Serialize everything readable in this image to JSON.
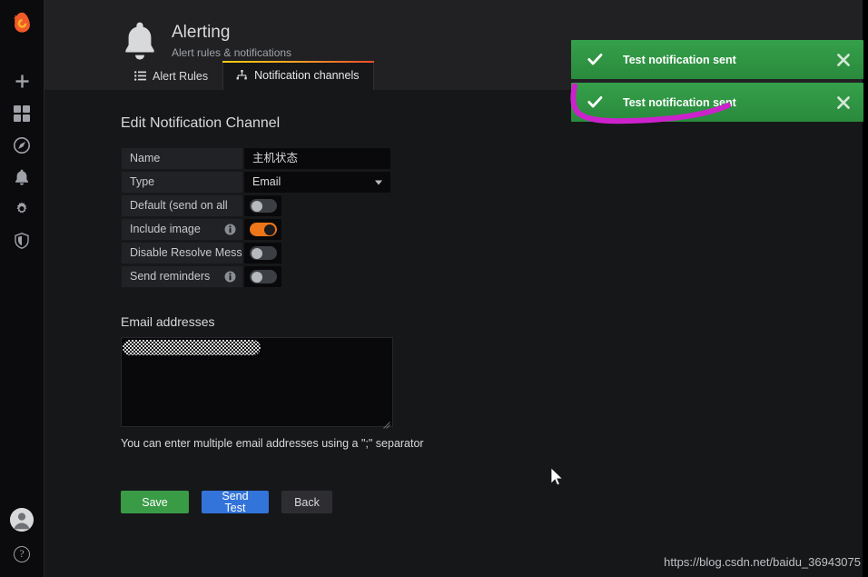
{
  "sidebar": {
    "logo": "grafana-logo",
    "items": [
      {
        "icon": "plus-icon",
        "name": "create"
      },
      {
        "icon": "dashboards-icon",
        "name": "dashboards"
      },
      {
        "icon": "compass-icon",
        "name": "explore"
      },
      {
        "icon": "bell-icon",
        "name": "alerting"
      },
      {
        "icon": "gear-icon",
        "name": "configuration"
      },
      {
        "icon": "shield-icon",
        "name": "server-admin"
      }
    ],
    "avatar": "user-avatar",
    "help": "?"
  },
  "header": {
    "icon": "bell-icon",
    "title": "Alerting",
    "subtitle": "Alert rules & notifications"
  },
  "tabs": [
    {
      "label": "Alert Rules",
      "icon": "list-icon",
      "active": false
    },
    {
      "label": "Notification channels",
      "icon": "sitemap-icon",
      "active": true
    }
  ],
  "form": {
    "section_title": "Edit Notification Channel",
    "name": {
      "label": "Name",
      "value": "主机状态"
    },
    "type": {
      "label": "Type",
      "value": "Email",
      "options": [
        "Email"
      ]
    },
    "toggles": [
      {
        "label": "Default (send on all",
        "has_info": false,
        "on": false
      },
      {
        "label": "Include image",
        "has_info": true,
        "on": true
      },
      {
        "label": "Disable Resolve Message",
        "has_info": false,
        "on": false
      },
      {
        "label": "Send reminders",
        "has_info": true,
        "on": false
      }
    ],
    "email": {
      "heading": "Email addresses",
      "value": "",
      "redacted": true,
      "hint": "You can enter multiple email addresses using a \";\" separator"
    },
    "buttons": {
      "save": "Save",
      "send_test": "Send\nTest",
      "back": "Back"
    }
  },
  "toasts": [
    {
      "message": "Test notification sent",
      "icon": "check-icon",
      "close": "close-icon"
    },
    {
      "message": "Test notification sent",
      "icon": "check-icon",
      "close": "close-icon"
    }
  ],
  "annotation": {
    "type": "freehand-underline",
    "color": "#cc22cc"
  },
  "watermark": "https://blog.csdn.net/baidu_36943075",
  "colors": {
    "accent_orange": "#ee7518",
    "toast_green": "#2f9447",
    "save_green": "#3a9b46",
    "test_blue": "#3274d9",
    "back_gray": "#2e2e32",
    "annotation_magenta": "#cc22cc",
    "page_bg": "#161719",
    "header_bg": "#212124",
    "sidebar_bg": "#0b0a0c"
  }
}
